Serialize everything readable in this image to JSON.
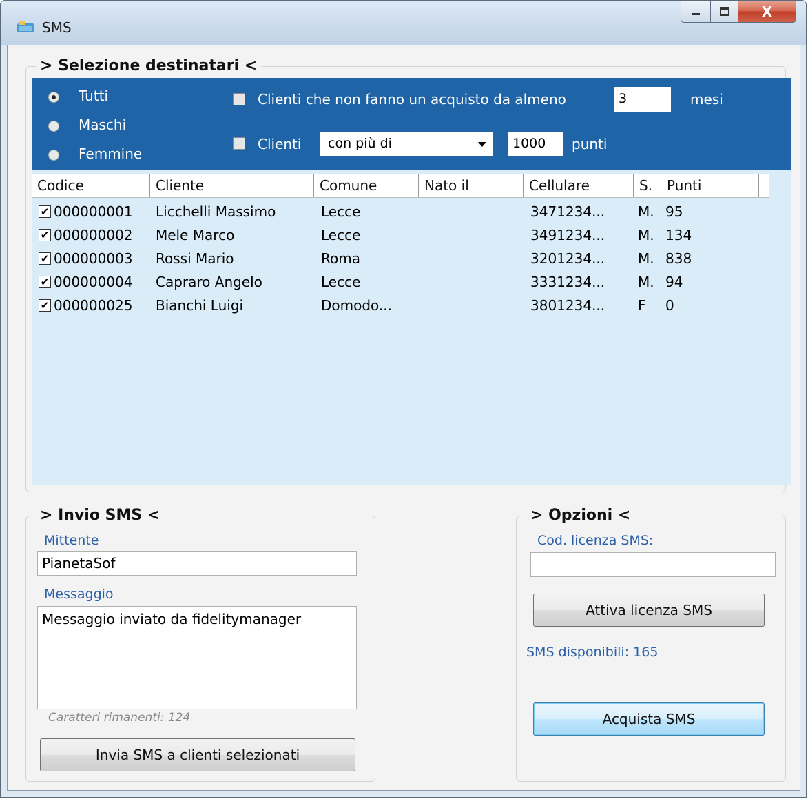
{
  "window": {
    "title": "SMS",
    "close_glyph": "X"
  },
  "selection": {
    "title": "> Selezione destinatari <",
    "radios": [
      {
        "label": "Tutti",
        "selected": true
      },
      {
        "label": "Maschi",
        "selected": false
      },
      {
        "label": "Femmine",
        "selected": false
      }
    ],
    "filter_months": {
      "label": "Clienti che non fanno un acquisto da almeno",
      "value": "3",
      "unit": "mesi",
      "checked": false
    },
    "filter_points": {
      "label": "Clienti",
      "operator": "con più di",
      "value": "1000",
      "unit": "punti",
      "checked": false
    }
  },
  "grid": {
    "columns": [
      "Codice",
      "Cliente",
      "Comune",
      "Nato il",
      "Cellulare",
      "S.",
      "Punti"
    ],
    "rows": [
      {
        "codice": "000000001",
        "cliente": "Licchelli Massimo",
        "comune": "Lecce",
        "nato": "",
        "cellulare": "3471234...",
        "sesso": "M.",
        "punti": "95",
        "checked": true
      },
      {
        "codice": "000000002",
        "cliente": "Mele Marco",
        "comune": "Lecce",
        "nato": "",
        "cellulare": "3491234...",
        "sesso": "M.",
        "punti": "134",
        "checked": true
      },
      {
        "codice": "000000003",
        "cliente": "Rossi Mario",
        "comune": "Roma",
        "nato": "",
        "cellulare": "3201234...",
        "sesso": "M.",
        "punti": "838",
        "checked": true
      },
      {
        "codice": "000000004",
        "cliente": "Capraro Angelo",
        "comune": "Lecce",
        "nato": "",
        "cellulare": "3331234...",
        "sesso": "M.",
        "punti": "94",
        "checked": true
      },
      {
        "codice": "000000025",
        "cliente": "Bianchi Luigi",
        "comune": "Domodo...",
        "nato": "",
        "cellulare": "3801234...",
        "sesso": "F",
        "punti": "0",
        "checked": true
      }
    ],
    "check_glyph": "✔"
  },
  "invio": {
    "title": "> Invio SMS <",
    "mittente_label": "Mittente",
    "mittente_value": "PianetaSof",
    "messaggio_label": "Messaggio",
    "messaggio_value": "Messaggio inviato da fidelitymanager",
    "remaining": "Caratteri rimanenti: 124",
    "send_button": "Invia SMS a clienti selezionati"
  },
  "opzioni": {
    "title": "> Opzioni <",
    "licenza_label": "Cod. licenza SMS:",
    "licenza_value": "",
    "attiva_button": "Attiva licenza SMS",
    "disponibili": "SMS disponibili: 165",
    "acquista_button": "Acquista SMS"
  },
  "colors": {
    "panel_blue": "#1e64a6",
    "grid_bg": "#d9ecf7",
    "label_blue": "#2b5fa8"
  }
}
